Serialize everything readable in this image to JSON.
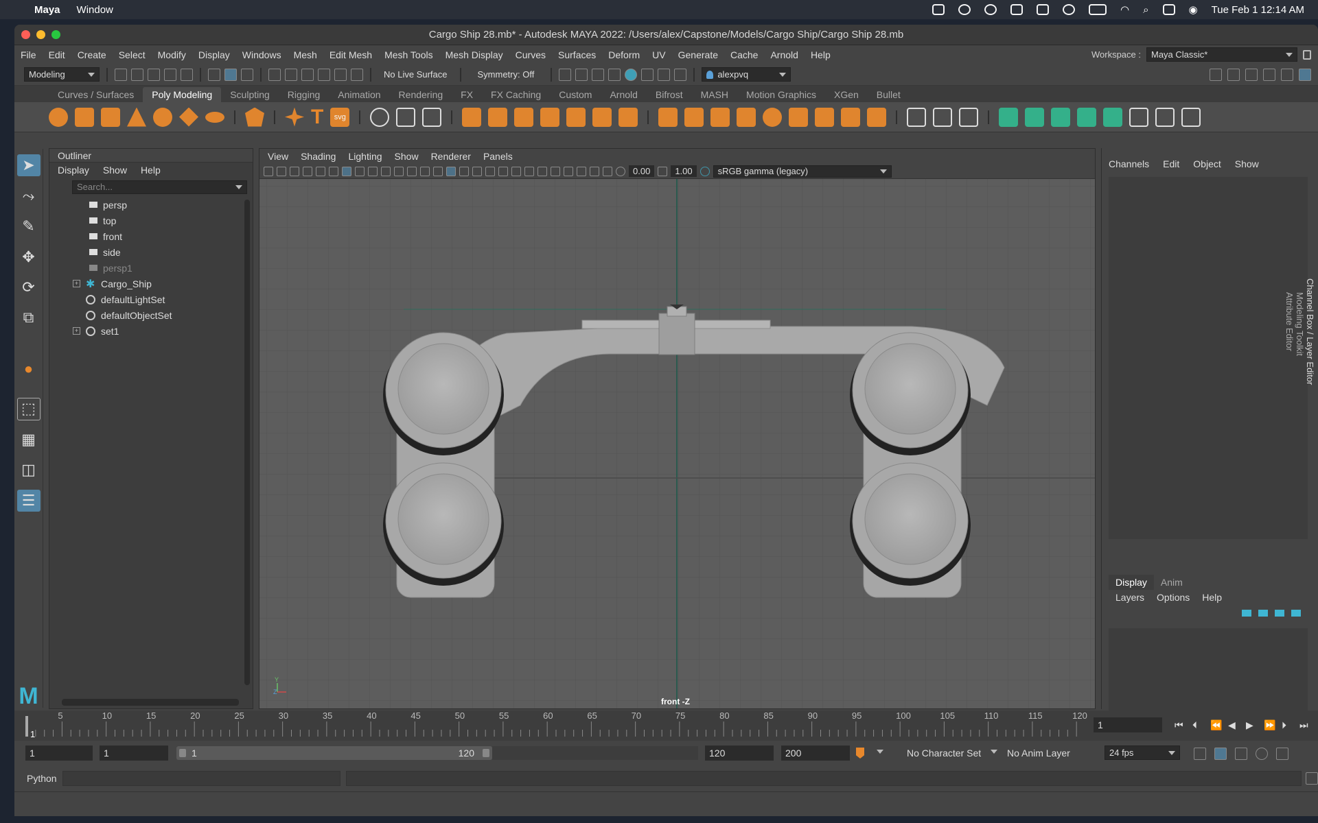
{
  "macos": {
    "app_name": "Maya",
    "menu": [
      "Window"
    ],
    "datetime": "Tue Feb 1  12:14 AM"
  },
  "window": {
    "title": "Cargo Ship 28.mb* - Autodesk MAYA 2022: /Users/alex/Capstone/Models/Cargo Ship/Cargo Ship 28.mb"
  },
  "menubar": {
    "items": [
      "File",
      "Edit",
      "Create",
      "Select",
      "Modify",
      "Display",
      "Windows",
      "Mesh",
      "Edit Mesh",
      "Mesh Tools",
      "Mesh Display",
      "Curves",
      "Surfaces",
      "Deform",
      "UV",
      "Generate",
      "Cache",
      "Arnold",
      "Help"
    ],
    "workspace_label": "Workspace :",
    "workspace_value": "Maya Classic*"
  },
  "statusline": {
    "mode": "Modeling",
    "live_surface": "No Live Surface",
    "symmetry": "Symmetry: Off",
    "user": "alexpvq"
  },
  "shelf": {
    "tabs": [
      "Curves / Surfaces",
      "Poly Modeling",
      "Sculpting",
      "Rigging",
      "Animation",
      "Rendering",
      "FX",
      "FX Caching",
      "Custom",
      "Arnold",
      "Bifrost",
      "MASH",
      "Motion Graphics",
      "XGen",
      "Bullet"
    ],
    "active_tab": "Poly Modeling"
  },
  "outliner": {
    "title": "Outliner",
    "menu": [
      "Display",
      "Show",
      "Help"
    ],
    "search_placeholder": "Search...",
    "nodes": [
      "persp",
      "top",
      "front",
      "side",
      "persp1",
      "Cargo_Ship",
      "defaultLightSet",
      "defaultObjectSet",
      "set1"
    ]
  },
  "viewport": {
    "menu": [
      "View",
      "Shading",
      "Lighting",
      "Show",
      "Renderer",
      "Panels"
    ],
    "exposure": "0.00",
    "gamma": "1.00",
    "color_space": "sRGB gamma (legacy)",
    "camera_label": "front -Z",
    "axis_y": "Y",
    "axis_z": "Z"
  },
  "channelbox": {
    "menu": [
      "Channels",
      "Edit",
      "Object",
      "Show"
    ],
    "side_tabs": "Channel Box / Layer Editor",
    "side_tabs2": "Modeling Toolkit",
    "side_tabs3": "Attribute Editor",
    "layer_tabs": [
      "Display",
      "Anim"
    ],
    "layer_menu": [
      "Layers",
      "Options",
      "Help"
    ]
  },
  "timeline": {
    "ticks": [
      "5",
      "10",
      "15",
      "20",
      "25",
      "30",
      "35",
      "40",
      "45",
      "50",
      "55",
      "60",
      "65",
      "70",
      "75",
      "80",
      "85",
      "90",
      "95",
      "100",
      "105",
      "110",
      "115",
      "120"
    ],
    "current_frame": "1",
    "frame_field": "1"
  },
  "range": {
    "start": "1",
    "playback_start": "1",
    "slider_start": "1",
    "slider_end": "120",
    "playback_end": "120",
    "end": "200",
    "character_set": "No Character Set",
    "anim_layer": "No Anim Layer",
    "fps": "24 fps"
  },
  "cmdline": {
    "label": "Python"
  }
}
